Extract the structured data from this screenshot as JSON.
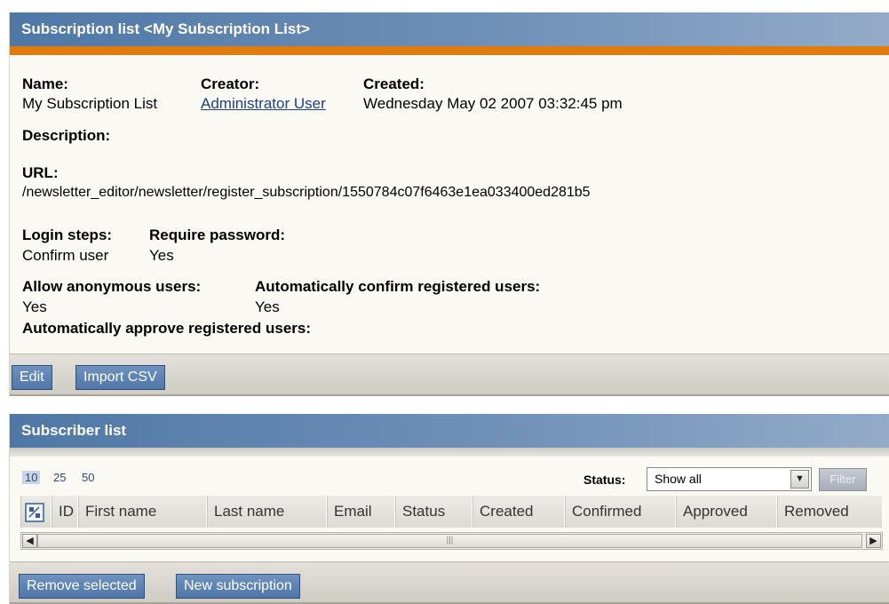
{
  "subscription_panel": {
    "title": "Subscription list <My Subscription List>",
    "name_label": "Name:",
    "name_value": "My Subscription List",
    "creator_label": "Creator:",
    "creator_value": "Administrator User",
    "created_label": "Created:",
    "created_value": "Wednesday May 02 2007 03:32:45 pm",
    "description_label": "Description:",
    "url_label": "URL:",
    "url_value": "/newsletter_editor/newsletter/register_subscription/1550784c07f6463e1ea033400ed281b5",
    "login_steps_label": "Login steps:",
    "login_steps_value": "Confirm user",
    "require_password_label": "Require password:",
    "require_password_value": "Yes",
    "allow_anonymous_label": "Allow anonymous users:",
    "allow_anonymous_value": "Yes",
    "auto_confirm_label": "Automatically confirm registered users:",
    "auto_confirm_value": "Yes",
    "auto_approve_label": "Automatically approve registered users:",
    "edit_label": "Edit",
    "import_label": "Import CSV"
  },
  "subscriber_panel": {
    "title": "Subscriber list",
    "page_sizes": [
      "10",
      "25",
      "50"
    ],
    "status_label": "Status:",
    "status_selected": "Show all",
    "filter_label": "Filter",
    "columns": [
      "ID",
      "First name",
      "Last name",
      "Email",
      "Status",
      "Created",
      "Confirmed",
      "Approved",
      "Removed"
    ],
    "remove_selected_label": "Remove selected",
    "new_subscription_label": "New subscription"
  },
  "colors": {
    "header_blue": "#4f78a6",
    "accent_orange": "#e07b0e",
    "button_blue": "#5b81b1"
  }
}
